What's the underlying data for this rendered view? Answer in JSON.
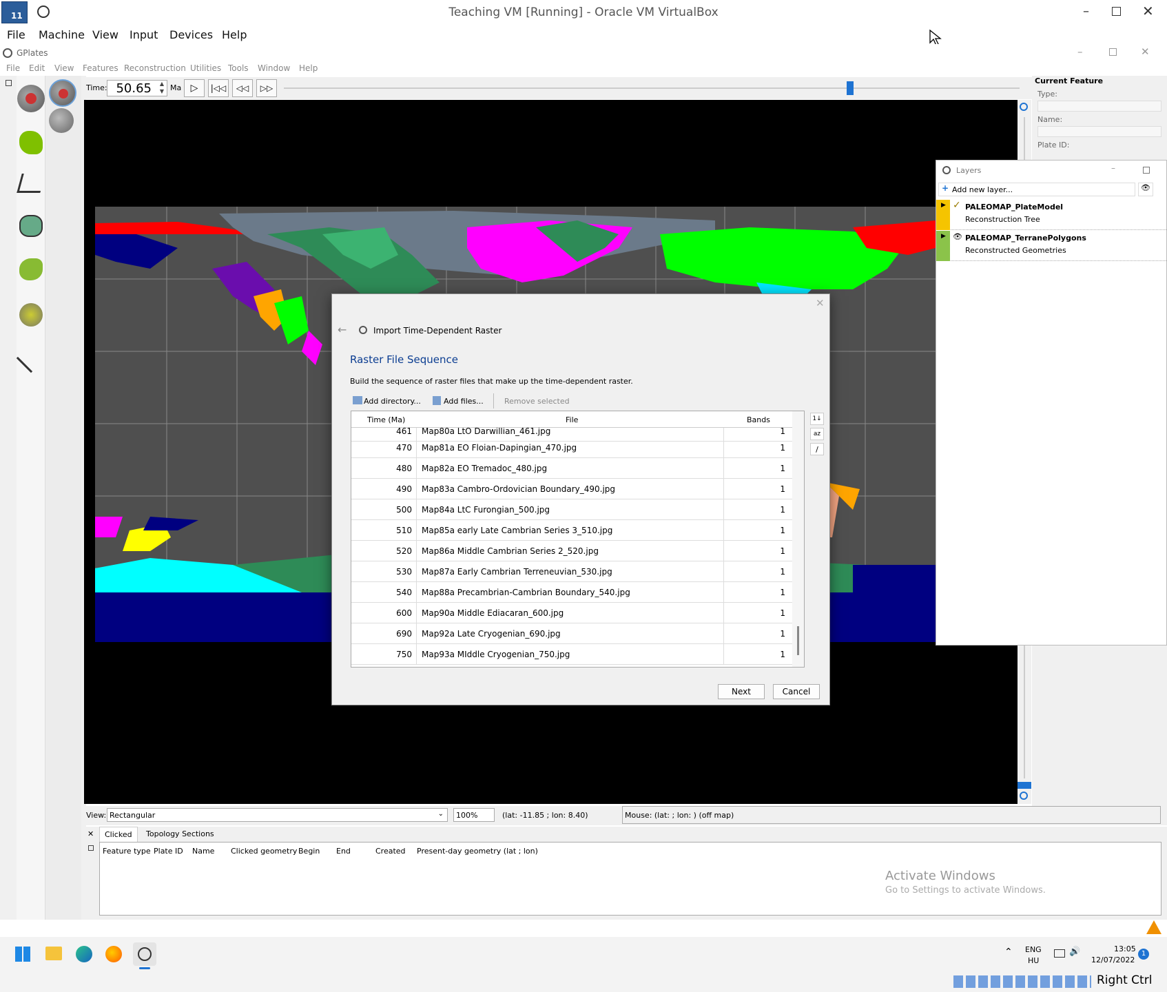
{
  "host": {
    "title": "Teaching VM [Running] - Oracle VM VirtualBox",
    "menu": [
      "File",
      "Machine",
      "View",
      "Input",
      "Devices",
      "Help"
    ],
    "badge": "11"
  },
  "gplates": {
    "title": "GPlates",
    "menu": [
      "File",
      "Edit",
      "View",
      "Features",
      "Reconstruction",
      "Utilities",
      "Tools",
      "Window",
      "Help"
    ],
    "time_label": "Time:",
    "time_value": "50.65",
    "time_unit": "Ma",
    "time_slider_fraction": 0.77
  },
  "current_feature": {
    "heading": "Current Feature",
    "type_label": "Type:",
    "name_label": "Name:",
    "plate_label": "Plate ID:"
  },
  "layers": {
    "title": "Layers",
    "add_label": "Add new layer...",
    "items": [
      {
        "name": "PALEOMAP_PlateModel",
        "sub": "Reconstruction Tree",
        "color": "#f5c400"
      },
      {
        "name": "PALEOMAP_TerranePolygons",
        "sub": "Reconstructed Geometries",
        "color": "#8bc34a"
      }
    ]
  },
  "dialog": {
    "title": "Import Time-Dependent Raster",
    "heading": "Raster File Sequence",
    "description": "Build the sequence of raster files that make up the time-dependent raster.",
    "add_directory": "Add directory...",
    "add_files": "Add files...",
    "remove_selected": "Remove selected",
    "columns": [
      "Time (Ma)",
      "File",
      "Bands"
    ],
    "partial_row": {
      "time": "461",
      "file": "Map80a LtO Darwillian_461.jpg",
      "bands": "1"
    },
    "rows": [
      {
        "time": "470",
        "file": "Map81a EO Floian-Dapingian_470.jpg",
        "bands": "1"
      },
      {
        "time": "480",
        "file": "Map82a EO Tremadoc_480.jpg",
        "bands": "1"
      },
      {
        "time": "490",
        "file": "Map83a Cambro-Ordovician Boundary_490.jpg",
        "bands": "1"
      },
      {
        "time": "500",
        "file": "Map84a LtC Furongian_500.jpg",
        "bands": "1"
      },
      {
        "time": "510",
        "file": "Map85a early Late Cambrian Series 3_510.jpg",
        "bands": "1"
      },
      {
        "time": "520",
        "file": "Map86a Middle Cambrian Series 2_520.jpg",
        "bands": "1"
      },
      {
        "time": "530",
        "file": "Map87a Early Cambrian Terreneuvian_530.jpg",
        "bands": "1"
      },
      {
        "time": "540",
        "file": "Map88a Precambrian-Cambrian Boundary_540.jpg",
        "bands": "1"
      },
      {
        "time": "600",
        "file": "Map90a Middle Ediacaran_600.jpg",
        "bands": "1"
      },
      {
        "time": "690",
        "file": "Map92a Late Cryogenian_690.jpg",
        "bands": "1"
      },
      {
        "time": "750",
        "file": "Map93a MIddle Cryogenian_750.jpg",
        "bands": "1"
      }
    ],
    "next": "Next",
    "cancel": "Cancel"
  },
  "statusbar": {
    "view_label": "View:",
    "view_value": "Rectangular",
    "zoom": "100%",
    "coords": "(lat: -11.85 ; lon: 8.40)",
    "mouse": "Mouse: (lat:  ; lon: ) (off map)"
  },
  "bottom": {
    "tabs": [
      "Clicked",
      "Topology Sections"
    ],
    "columns": [
      "Feature type",
      "Plate ID",
      "Name",
      "Clicked geometry",
      "Begin",
      "End",
      "Created",
      "Present-day geometry (lat ; lon)"
    ]
  },
  "watermark": {
    "line1": "Activate Windows",
    "line2": "Go to Settings to activate Windows."
  },
  "taskbar": {
    "lang1": "ENG",
    "lang2": "HU",
    "time": "13:05",
    "date": "12/07/2022",
    "notif": "1"
  },
  "vbox_status": {
    "host_key": "Right Ctrl"
  }
}
